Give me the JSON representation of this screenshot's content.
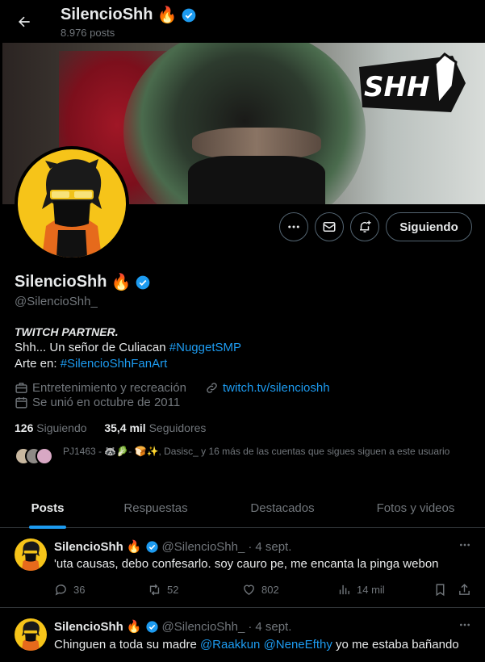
{
  "header": {
    "name": "SilencioShh",
    "name_emoji": "🔥",
    "post_count": "8.976 posts"
  },
  "banner": {
    "logo_text": "SHH"
  },
  "profile": {
    "name": "SilencioShh",
    "name_emoji": "🔥",
    "handle": "@SilencioShh_",
    "follow_label": "Siguiendo",
    "bio": {
      "line1": "TWITCH PARTNER.",
      "line2_text": "Shh... Un señor de Culiacan ",
      "line2_tag": "#NuggetSMP",
      "line3_text": "Arte en: ",
      "line3_tag": "#SilencioShhFanArt"
    },
    "category": "Entretenimiento y recreación",
    "link": "twitch.tv/silencioshh",
    "joined": "Se unió en octubre de 2011",
    "following_count": "126",
    "following_label": "Siguiendo",
    "followers_count": "35,4 mil",
    "followers_label": "Seguidores",
    "mutuals": "PJ1463 - 🦝🥬- 🍞✨, Dasisc_ y 16 más de las cuentas que sigues siguen a este usuario"
  },
  "tabs": [
    "Posts",
    "Respuestas",
    "Destacados",
    "Fotos y videos"
  ],
  "tweets": [
    {
      "name": "SilencioShh",
      "emoji": "🔥",
      "handle": "@SilencioShh_",
      "sep": "·",
      "date": "4 sept.",
      "text": "'uta causas, debo confesarlo. soy cauro pe, me encanta la pinga webon",
      "replies": "36",
      "retweets": "52",
      "likes": "802",
      "views": "14 mil"
    },
    {
      "name": "SilencioShh",
      "emoji": "🔥",
      "handle": "@SilencioShh_",
      "sep": "·",
      "date": "4 sept.",
      "text_before": "Chinguen a toda su madre ",
      "mention1": "@Raakkun",
      "mention2": "@NeneEfthy",
      "text_after": " yo me estaba bañando"
    }
  ],
  "colors": {
    "accent": "#1d9bf0",
    "muted": "#71767b",
    "border": "#2f3336",
    "avatar_bg": "#f6c419"
  }
}
